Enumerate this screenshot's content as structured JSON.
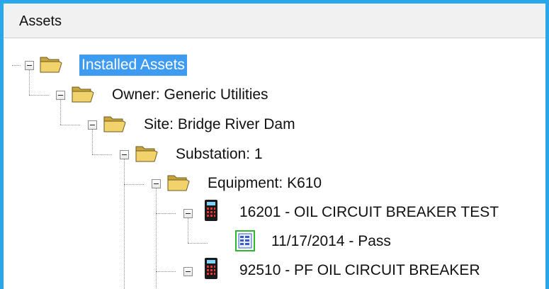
{
  "panel": {
    "title": "Assets"
  },
  "tree": {
    "root": {
      "label": "Installed Assets",
      "selected": true,
      "icon": "folder-open-icon"
    },
    "owner": {
      "label": "Owner: Generic Utilities",
      "icon": "folder-open-icon"
    },
    "site": {
      "label": "Site: Bridge River Dam",
      "icon": "folder-open-icon"
    },
    "substation": {
      "label": "Substation: 1",
      "icon": "folder-open-icon"
    },
    "equipment": {
      "label": "Equipment: K610",
      "icon": "folder-open-icon"
    },
    "test1": {
      "label": "16201 - OIL CIRCUIT BREAKER TEST",
      "icon": "test-set-icon"
    },
    "result1": {
      "label": "11/17/2014 - Pass",
      "icon": "test-result-icon"
    },
    "test2": {
      "label": "92510 - PF OIL CIRCUIT BREAKER",
      "icon": "test-set-icon"
    }
  },
  "colors": {
    "selection": "#3d9bf2",
    "border": "#2aa7ea",
    "folder": "#f2d36b",
    "result": "#2db82d"
  }
}
